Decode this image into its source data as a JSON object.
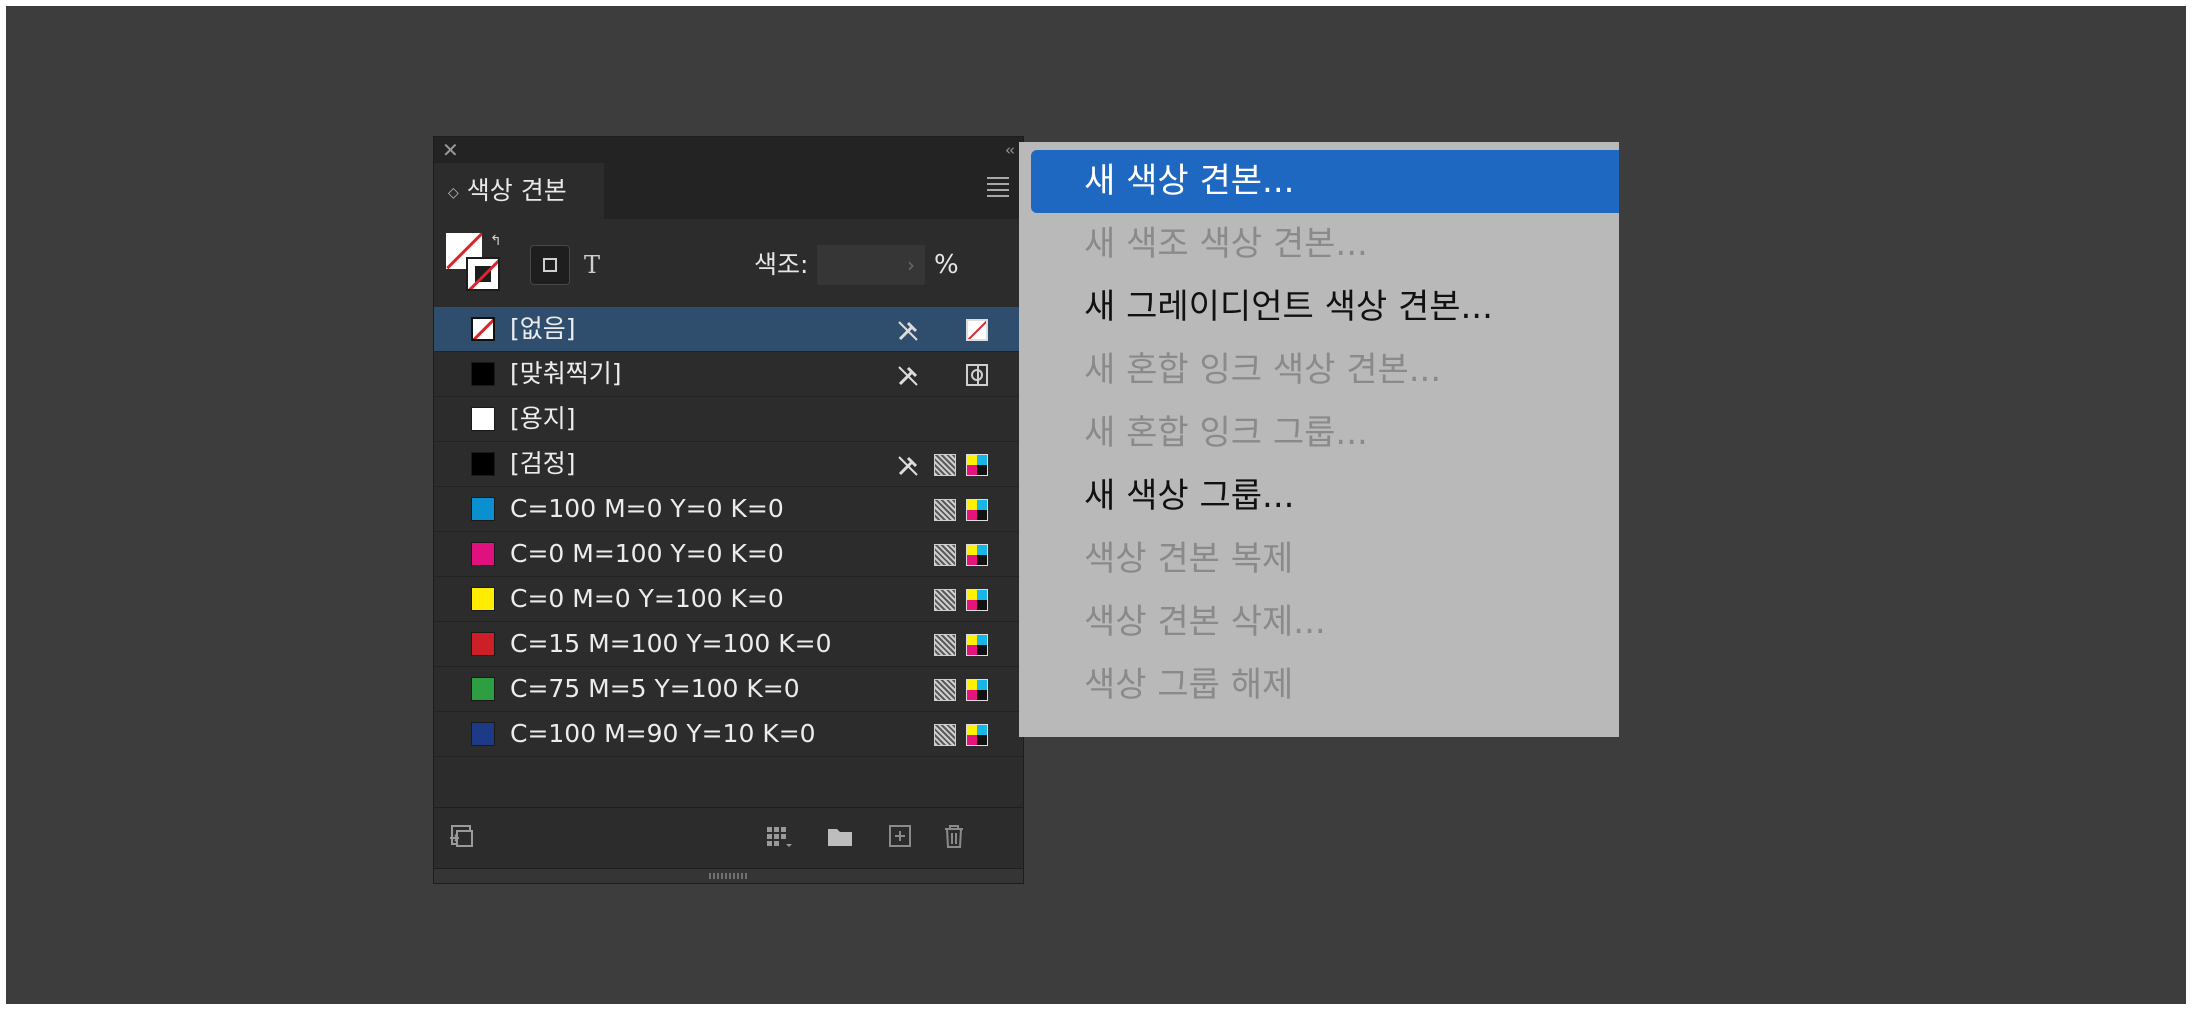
{
  "panel": {
    "close_symbol": "✕",
    "collapse_symbol": "‹‹",
    "tab_title": "색상 견본",
    "tint": {
      "label": "색조:",
      "value": "",
      "unit": "%"
    },
    "swatches": [
      {
        "label": "[없음]",
        "color": "none",
        "icons": [
          "no-edit-icon",
          "none-swatch-icon"
        ],
        "selected": true
      },
      {
        "label": "[맞춰찍기]",
        "color": "#000000",
        "icons": [
          "no-edit-icon",
          "registration-icon"
        ]
      },
      {
        "label": "[용지]",
        "color": "#ffffff",
        "icons": []
      },
      {
        "label": "[검정]",
        "color": "#000000",
        "icons": [
          "no-edit-icon",
          "process-color-icon",
          "cmyk-icon"
        ]
      },
      {
        "label": "C=100 M=0 Y=0 K=0",
        "color": "#0a8fd0",
        "icons": [
          "process-color-icon",
          "cmyk-icon"
        ]
      },
      {
        "label": "C=0 M=100 Y=0 K=0",
        "color": "#e0117f",
        "icons": [
          "process-color-icon",
          "cmyk-icon"
        ]
      },
      {
        "label": "C=0 M=0 Y=100 K=0",
        "color": "#ffec00",
        "icons": [
          "process-color-icon",
          "cmyk-icon"
        ]
      },
      {
        "label": "C=15 M=100 Y=100 K=0",
        "color": "#cc1f27",
        "icons": [
          "process-color-icon",
          "cmyk-icon"
        ]
      },
      {
        "label": "C=75 M=5 Y=100 K=0",
        "color": "#2e9e42",
        "icons": [
          "process-color-icon",
          "cmyk-icon"
        ]
      },
      {
        "label": "C=100 M=90 Y=10 K=0",
        "color": "#1d3a86",
        "icons": [
          "process-color-icon",
          "cmyk-icon"
        ]
      }
    ]
  },
  "menu": {
    "items": [
      {
        "label": "새 색상 견본...",
        "state": "highlighted"
      },
      {
        "label": "새 색조 색상 견본...",
        "state": "disabled"
      },
      {
        "label": "새 그레이디언트 색상 견본...",
        "state": "enabled"
      },
      {
        "label": "새 혼합 잉크 색상 견본...",
        "state": "disabled"
      },
      {
        "label": "새 혼합 잉크 그룹...",
        "state": "disabled"
      },
      {
        "label": "새 색상 그룹...",
        "state": "enabled"
      },
      {
        "label": "색상 견본 복제",
        "state": "disabled"
      },
      {
        "label": "색상 견본 삭제...",
        "state": "disabled"
      },
      {
        "label": "색상 그룹 해제",
        "state": "disabled"
      }
    ]
  },
  "colors": {
    "background": "#3d3d3d",
    "panel": "#2c2c2c",
    "selection": "#2f4e6e",
    "menu_bg": "#b9b9b9",
    "menu_highlight": "#1f68c1"
  }
}
